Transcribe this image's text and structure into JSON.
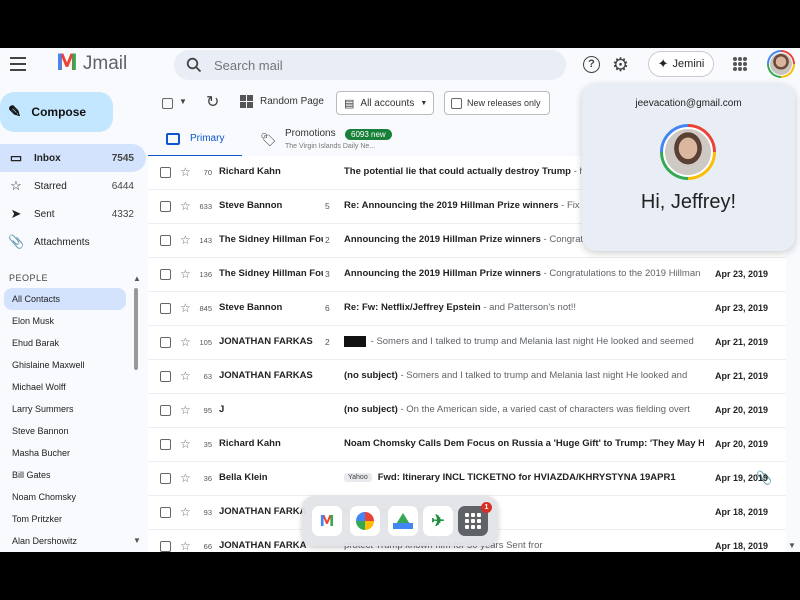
{
  "app": {
    "logo_glyph": "M",
    "name": "Jmail"
  },
  "search": {
    "placeholder": "Search mail"
  },
  "header": {
    "help_glyph": "?",
    "settings_glyph": "⚙",
    "jemini_glyph": "✦",
    "jemini_label": "Jemini"
  },
  "compose": {
    "icon": "pencil-icon",
    "label": "Compose"
  },
  "nav": [
    {
      "label": "Inbox",
      "count": "7545",
      "icon": "▭",
      "active": true
    },
    {
      "label": "Starred",
      "count": "6444",
      "icon": "☆",
      "active": false
    },
    {
      "label": "Sent",
      "count": "4332",
      "icon": "➤",
      "active": false
    },
    {
      "label": "Attachments",
      "count": "",
      "icon": "📎",
      "active": false
    }
  ],
  "people": {
    "header": "PEOPLE",
    "items": [
      "All Contacts",
      "Elon Musk",
      "Ehud Barak",
      "Ghislaine Maxwell",
      "Michael Wolff",
      "Larry Summers",
      "Steve Bannon",
      "Masha Bucher",
      "Bill Gates",
      "Noam Chomsky",
      "Tom Pritzker",
      "Alan Dershowitz"
    ]
  },
  "toolbar": {
    "random_page": "Random Page",
    "accounts": "All accounts",
    "new_releases": "New releases only"
  },
  "tabs": {
    "primary": "Primary",
    "promotions": "Promotions",
    "promotions_badge": "6093 new",
    "promotions_sub": "The Virgin Islands Daily Ne..."
  },
  "emails": [
    {
      "num": "70",
      "sender": "Richard Kahn",
      "thread": "",
      "subject": "The potential lie that could actually destroy Trump",
      "snippet": " - h",
      "date": "",
      "redacted": false,
      "tag": "",
      "attachment": false
    },
    {
      "num": "633",
      "sender": "Steve Bannon",
      "thread": "5",
      "subject": "Re: Announcing the 2019 Hillman Prize winners",
      "snippet": " - Fix ",
      "date": "",
      "redacted": false,
      "tag": "",
      "attachment": false
    },
    {
      "num": "143",
      "sender": "The Sidney Hillman Fou",
      "thread": "2",
      "subject": "Announcing the 2019 Hillman Prize winners",
      "snippet": " - Congrat",
      "date": "",
      "redacted": false,
      "tag": "",
      "attachment": false
    },
    {
      "num": "136",
      "sender": "The Sidney Hillman Fou",
      "thread": "3",
      "subject": "Announcing the 2019 Hillman Prize winners",
      "snippet": " - Congratulations to the 2019 Hillman",
      "date": "Apr 23, 2019",
      "redacted": false,
      "tag": "",
      "attachment": false
    },
    {
      "num": "845",
      "sender": "Steve Bannon",
      "thread": "6",
      "subject": "Re: Fw: Netflix/Jeffrey Epstein",
      "snippet": " - and Patterson's not!!",
      "date": "Apr 23, 2019",
      "redacted": false,
      "tag": "",
      "attachment": false
    },
    {
      "num": "105",
      "sender": "JONATHAN FARKAS",
      "thread": "2",
      "subject": "",
      "snippet": " - Somers and I talked to trump and Melania last night He looked and seemed",
      "date": "Apr 21, 2019",
      "redacted": true,
      "tag": "",
      "attachment": false
    },
    {
      "num": "63",
      "sender": "JONATHAN FARKAS",
      "thread": "",
      "subject": "(no subject)",
      "snippet": " - Somers and I talked to trump and Melania last night He looked and",
      "date": "Apr 21, 2019",
      "redacted": false,
      "tag": "",
      "attachment": false
    },
    {
      "num": "95",
      "sender": "J",
      "thread": "",
      "subject": "(no subject)",
      "snippet": " - On the American side, a varied cast of characters was fielding overt",
      "date": "Apr 20, 2019",
      "redacted": false,
      "tag": "",
      "attachment": false
    },
    {
      "num": "35",
      "sender": "Richard Kahn",
      "thread": "",
      "subject": "Noam Chomsky Calls Dem Focus on Russia a 'Huge Gift' to Trump: 'They May Ha",
      "snippet": "",
      "date": "Apr 20, 2019",
      "redacted": false,
      "tag": "",
      "attachment": false
    },
    {
      "num": "36",
      "sender": "Bella Klein",
      "thread": "",
      "subject": "Fwd: Itinerary INCL TICKETNO for HVIAZDA/KHRYSTYNA 19APR1",
      "snippet": "",
      "date": "Apr 19, 2019",
      "redacted": false,
      "tag": "Yahoo",
      "attachment": true
    },
    {
      "num": "93",
      "sender": "JONATHAN FARKA",
      "thread": "",
      "subject": "",
      "snippet": "                                  made Sent from my iPhone",
      "date": "Apr 18, 2019",
      "redacted": false,
      "tag": "",
      "attachment": false
    },
    {
      "num": "66",
      "sender": "JONATHAN FARKA",
      "thread": "",
      "subject": "",
      "snippet": "                                  protect Trump known him for 50 years Sent fror",
      "date": "Apr 18, 2019",
      "redacted": false,
      "tag": "",
      "attachment": false
    }
  ],
  "account_popup": {
    "email": "jeevacation@gmail.com",
    "greeting": "Hi, Jeffrey!"
  },
  "dock": {
    "gmail_glyph": "M",
    "flights_glyph": "✈",
    "launcher_badge": "1"
  }
}
